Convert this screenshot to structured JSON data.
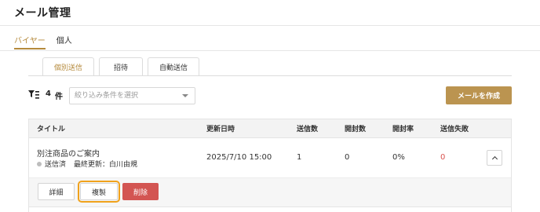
{
  "page": {
    "title": "メール管理"
  },
  "top_tabs": [
    {
      "label": "バイヤー",
      "active": true
    },
    {
      "label": "個人",
      "active": false
    }
  ],
  "sub_tabs": [
    {
      "label": "個別送信",
      "active": true
    },
    {
      "label": "招待",
      "active": false
    },
    {
      "label": "自動送信",
      "active": false
    }
  ],
  "toolbar": {
    "filter_icon": "filter-list-icon",
    "count": "4",
    "count_unit": "件",
    "filter_placeholder": "絞り込み条件を選択",
    "create_label": "メールを作成"
  },
  "table": {
    "headers": [
      "タイトル",
      "更新日時",
      "送信数",
      "開封数",
      "開封率",
      "送信失敗"
    ],
    "rows": [
      {
        "title": "別注商品のご案内",
        "status": "送信済",
        "last_updated_by": "最終更新：白川由規",
        "updated_at": "2025/7/10 15:00",
        "sent": "1",
        "opened": "0",
        "open_rate": "0%",
        "failed": "0"
      }
    ],
    "actions": {
      "detail_label": "詳細",
      "copy_label": "複製",
      "delete_label": "削除"
    }
  },
  "colors": {
    "accent": "#b58a3c",
    "primary_button": "#bb9450",
    "danger": "#d35552",
    "focus_outline": "#f0a21c",
    "fail_text": "#d9534f"
  }
}
